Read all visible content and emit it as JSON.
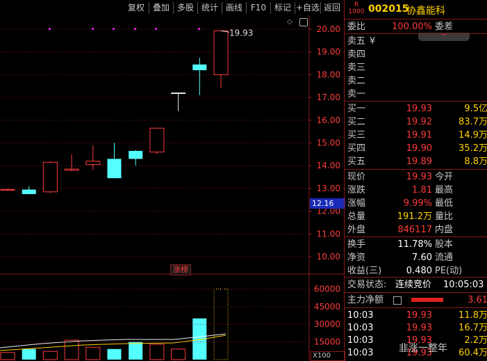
{
  "toolbar": {
    "items": [
      "复权",
      "叠加",
      "多股",
      "统计",
      "画线",
      "F10",
      "标记",
      "+自选",
      "返回"
    ]
  },
  "chart": {
    "price_axis": [
      "20.00",
      "19.00",
      "18.00",
      "17.00",
      "16.00",
      "15.00",
      "14.00",
      "13.00",
      "12.00",
      "11.00",
      "10.00"
    ],
    "current_price_tag": "12.16",
    "high_label": "19.93",
    "zhangbang_label": "涨榜",
    "vol_axis": [
      "60000",
      "45000",
      "30000",
      "15000"
    ],
    "vol_unit": "X100"
  },
  "chart_data": {
    "type": "candlestick",
    "ylim": [
      9.5,
      20.3
    ],
    "candles": [
      {
        "o": 12.95,
        "c": 12.95,
        "h": 13.0,
        "l": 12.9
      },
      {
        "o": 12.95,
        "c": 12.75,
        "h": 13.1,
        "l": 12.75
      },
      {
        "o": 12.85,
        "c": 14.15,
        "h": 14.2,
        "l": 12.8
      },
      {
        "o": 13.8,
        "c": 13.85,
        "h": 14.5,
        "l": 13.75
      },
      {
        "o": 14.05,
        "c": 14.2,
        "h": 14.9,
        "l": 13.8
      },
      {
        "o": 14.3,
        "c": 13.45,
        "h": 15.0,
        "l": 13.45
      },
      {
        "o": 14.65,
        "c": 14.3,
        "h": 14.7,
        "l": 14.0
      },
      {
        "o": 14.6,
        "c": 15.65,
        "h": 15.65,
        "l": 14.5
      },
      {
        "o": 17.2,
        "c": 17.2,
        "h": 17.2,
        "l": 16.4
      },
      {
        "o": 18.45,
        "c": 18.2,
        "h": 18.75,
        "l": 17.1
      },
      {
        "o": 18.0,
        "c": 19.93,
        "h": 19.93,
        "l": 17.4
      }
    ],
    "volumes": [
      6000,
      9000,
      7000,
      16500,
      10500,
      9000,
      15000,
      13000,
      9000,
      35000,
      60000
    ],
    "vol_max": 65000
  },
  "quote": {
    "code": "002015",
    "name": "协鑫能科",
    "r_tag": "R",
    "r_num": "1000",
    "weibi_label": "委比",
    "weibi_val": "100.00%",
    "weicha_label": "委差",
    "sell_labels": [
      "卖五",
      "卖四",
      "卖三",
      "卖二",
      "卖一"
    ],
    "sell_yen": "¥",
    "buys": [
      {
        "label": "买一",
        "price": "19.93",
        "vol": "9.5亿"
      },
      {
        "label": "买二",
        "price": "19.92",
        "vol": "83.7万"
      },
      {
        "label": "买三",
        "price": "19.91",
        "vol": "14.9万"
      },
      {
        "label": "买四",
        "price": "19.90",
        "vol": "35.2万"
      },
      {
        "label": "买五",
        "price": "19.89",
        "vol": "8.8万"
      }
    ],
    "stats": [
      {
        "l": "现价",
        "v": "19.93",
        "r": "今开"
      },
      {
        "l": "涨跌",
        "v": "1.81",
        "r": "最高"
      },
      {
        "l": "涨幅",
        "v": "9.99%",
        "r": "最低"
      },
      {
        "l": "总量",
        "v": "191.2万",
        "r": "量比"
      },
      {
        "l": "外盘",
        "v": "846117",
        "r": "内盘"
      }
    ],
    "stats2": [
      {
        "l": "换手",
        "v": "11.78%",
        "r": "股本"
      },
      {
        "l": "净资",
        "v": "7.60",
        "r": "流通"
      },
      {
        "l": "收益(三)",
        "v": "0.480",
        "r": "PE(动)"
      }
    ],
    "status_label": "交易状态:",
    "status_val": "连续竞价",
    "status_time": "10:05:03",
    "main_flow_label": "主力净额",
    "main_flow_val": "3.61",
    "ticks": [
      {
        "t": "10:03",
        "p": "19.93",
        "v": "11.8万"
      },
      {
        "t": "10:03",
        "p": "19.93",
        "v": "16.7万"
      },
      {
        "t": "10:03",
        "p": "19.93",
        "v": "2.2万"
      },
      {
        "t": "10:03",
        "p": "19.93",
        "v": "60.4万"
      }
    ],
    "watermark": "韭涨一整年"
  },
  "colors": {
    "up": "#ff3b3b",
    "down": "#54ffff",
    "grid": "#8b1a1a",
    "yellow": "#ffd200"
  }
}
